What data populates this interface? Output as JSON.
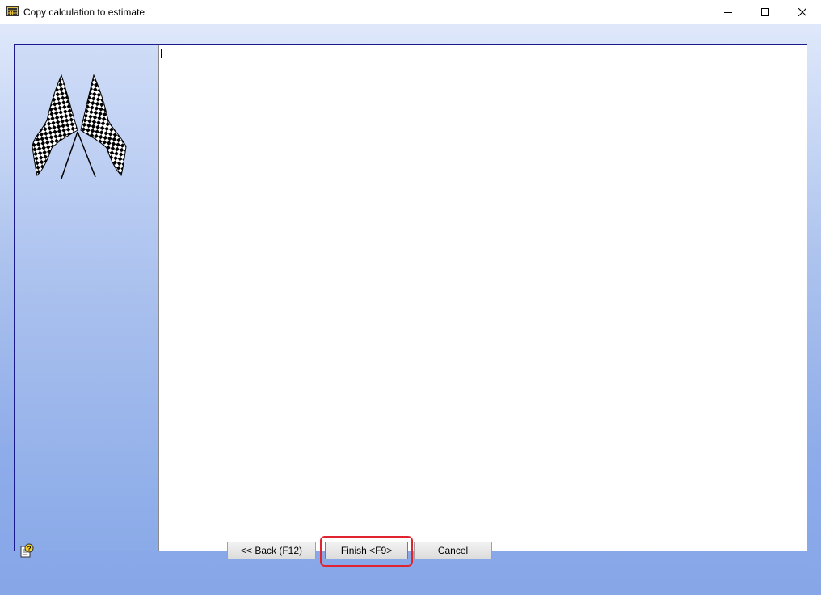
{
  "window": {
    "title": "Copy calculation to estimate",
    "icons": {
      "app": "calculator-icon",
      "minimize": "minimize-icon",
      "maximize": "maximize-icon",
      "close": "close-icon"
    }
  },
  "side_panel": {
    "image": "checkered-flags-icon"
  },
  "editor": {
    "value": ""
  },
  "footer": {
    "help_icon": "help-icon",
    "back_label": "<< Back (F12)",
    "finish_label": "Finish <F9>",
    "cancel_label": "Cancel"
  },
  "colors": {
    "frame_border": "#1a1a8c",
    "gradient_top": "#dfe8fb",
    "gradient_bottom": "#86a6e8",
    "highlight": "#e0242f"
  }
}
